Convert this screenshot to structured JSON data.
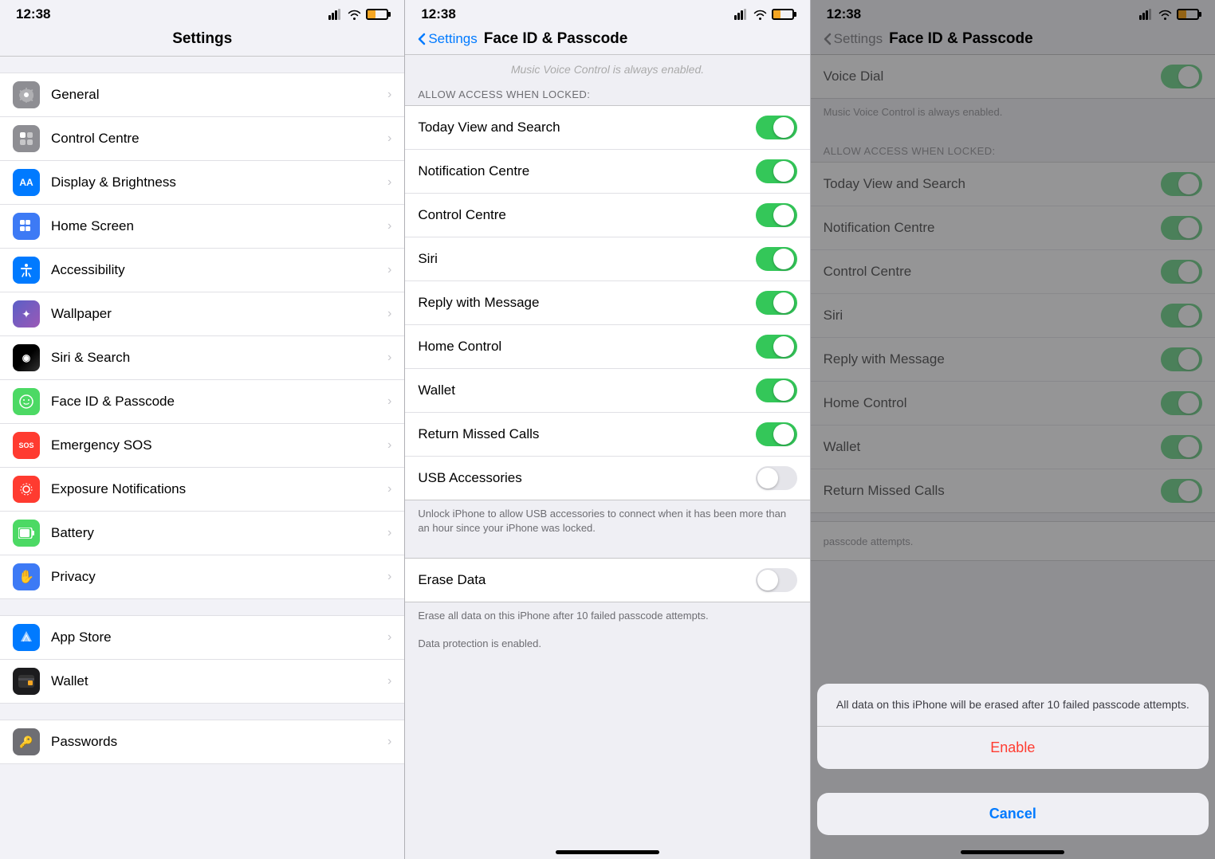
{
  "panel1": {
    "statusTime": "12:38",
    "title": "Settings",
    "items": [
      {
        "id": "general",
        "label": "General",
        "iconBg": "#8e8e93",
        "iconColor": "#fff",
        "iconSymbol": "⚙"
      },
      {
        "id": "control",
        "label": "Control Centre",
        "iconBg": "#8e8e93",
        "iconColor": "#fff",
        "iconSymbol": "⊞"
      },
      {
        "id": "display",
        "label": "Display & Brightness",
        "iconBg": "#007aff",
        "iconColor": "#fff",
        "iconSymbol": "AA"
      },
      {
        "id": "homescreen",
        "label": "Home Screen",
        "iconBg": "#3d7af5",
        "iconColor": "#fff",
        "iconSymbol": "⊞"
      },
      {
        "id": "accessibility",
        "label": "Accessibility",
        "iconBg": "#007aff",
        "iconColor": "#fff",
        "iconSymbol": "♿"
      },
      {
        "id": "wallpaper",
        "label": "Wallpaper",
        "iconBg": "#5b5fc7",
        "iconColor": "#fff",
        "iconSymbol": "✦"
      },
      {
        "id": "siri",
        "label": "Siri & Search",
        "iconBg": "#000",
        "iconColor": "#fff",
        "iconSymbol": "◉"
      },
      {
        "id": "faceid",
        "label": "Face ID & Passcode",
        "iconBg": "#4cd964",
        "iconColor": "#fff",
        "iconSymbol": "☺"
      },
      {
        "id": "sos",
        "label": "Emergency SOS",
        "iconBg": "#ff3b30",
        "iconColor": "#fff",
        "iconSymbol": "SOS"
      },
      {
        "id": "exposure",
        "label": "Exposure Notifications",
        "iconBg": "#ff3b30",
        "iconColor": "#fff",
        "iconSymbol": "⊙"
      },
      {
        "id": "battery",
        "label": "Battery",
        "iconBg": "#4cd964",
        "iconColor": "#fff",
        "iconSymbol": "▬"
      },
      {
        "id": "privacy",
        "label": "Privacy",
        "iconBg": "#3d7af5",
        "iconColor": "#fff",
        "iconSymbol": "✋"
      }
    ],
    "items2": [
      {
        "id": "appstore",
        "label": "App Store",
        "iconBg": "#007aff",
        "iconColor": "#fff",
        "iconSymbol": "A"
      },
      {
        "id": "wallet",
        "label": "Wallet",
        "iconBg": "#1c1c1e",
        "iconColor": "#fff",
        "iconSymbol": "◼"
      }
    ],
    "items3": [
      {
        "id": "passwords",
        "label": "Passwords",
        "iconBg": "#6e6e73",
        "iconColor": "#fff",
        "iconSymbol": "🔑"
      }
    ]
  },
  "panel2": {
    "statusTime": "12:38",
    "backLabel": "Settings",
    "title": "Face ID & Passcode",
    "sectionLabel": "ALLOW ACCESS WHEN LOCKED:",
    "fadedText": "Music Voice Control is always enabled.",
    "toggleRows": [
      {
        "id": "today",
        "label": "Today View and Search",
        "on": true
      },
      {
        "id": "notification",
        "label": "Notification Centre",
        "on": true
      },
      {
        "id": "control",
        "label": "Control Centre",
        "on": true
      },
      {
        "id": "siri",
        "label": "Siri",
        "on": true
      },
      {
        "id": "reply",
        "label": "Reply with Message",
        "on": true
      },
      {
        "id": "homecontrol",
        "label": "Home Control",
        "on": true
      },
      {
        "id": "wallet",
        "label": "Wallet",
        "on": true
      },
      {
        "id": "missed",
        "label": "Return Missed Calls",
        "on": true
      },
      {
        "id": "usb",
        "label": "USB Accessories",
        "on": false
      }
    ],
    "usbDescription": "Unlock iPhone to allow USB accessories to connect when it has been more than an hour since your iPhone was locked.",
    "eraseSection": {
      "label": "Erase Data",
      "on": false,
      "description": "Erase all data on this iPhone after 10 failed passcode attempts.",
      "dataProtection": "Data protection is enabled."
    }
  },
  "panel3": {
    "statusTime": "12:38",
    "backLabel": "Settings",
    "title": "Face ID & Passcode",
    "voiceDial": {
      "label": "Voice Dial",
      "on": true
    },
    "voiceControlNote": "Music Voice Control is always enabled.",
    "sectionLabel": "ALLOW ACCESS WHEN LOCKED:",
    "toggleRows": [
      {
        "id": "today",
        "label": "Today View and Search",
        "on": true
      },
      {
        "id": "notification",
        "label": "Notification Centre",
        "on": true
      },
      {
        "id": "control",
        "label": "Control Centre",
        "on": true
      },
      {
        "id": "siri",
        "label": "Siri",
        "on": true
      },
      {
        "id": "reply",
        "label": "Reply with Message",
        "on": true
      },
      {
        "id": "homecontrol",
        "label": "Home Control",
        "on": true
      },
      {
        "id": "wallet",
        "label": "Wallet",
        "on": true
      },
      {
        "id": "missed",
        "label": "Return Missed Calls",
        "on": true
      }
    ],
    "alert": {
      "message": "All data on this iPhone will be erased after 10 failed passcode attempts.",
      "enableLabel": "Enable",
      "cancelLabel": "Cancel"
    },
    "belowAlert": "passcode attempts."
  }
}
